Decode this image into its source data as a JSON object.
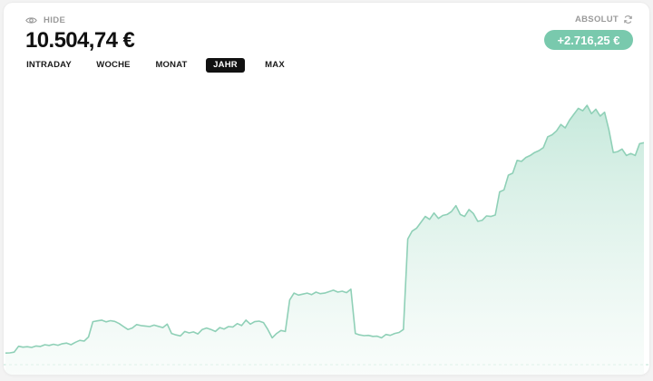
{
  "header": {
    "hide_label": "HIDE",
    "balance": "10.504,74 €",
    "mode_label": "ABSOLUT",
    "change": "+2.716,25 €"
  },
  "tabs": [
    {
      "label": "INTRADAY",
      "active": false
    },
    {
      "label": "WOCHE",
      "active": false
    },
    {
      "label": "MONAT",
      "active": false
    },
    {
      "label": "JAHR",
      "active": true
    },
    {
      "label": "MAX",
      "active": false
    }
  ],
  "colors": {
    "line": "#8fd0b7",
    "fill_top": "#c4e8da",
    "fill_bottom": "#f5fbf8",
    "badge": "#79c9ad",
    "baseline": "#bde3d3"
  },
  "icons": {
    "hide": "eye-icon",
    "mode": "refresh-icon"
  },
  "chart_data": {
    "type": "area",
    "title": "",
    "xlabel": "",
    "ylabel": "",
    "ylim": [
      7700,
      10800
    ],
    "values": [
      7790,
      7792,
      7800,
      7860,
      7850,
      7855,
      7848,
      7862,
      7858,
      7875,
      7868,
      7880,
      7870,
      7885,
      7892,
      7875,
      7900,
      7920,
      7912,
      7955,
      8110,
      8118,
      8125,
      8108,
      8120,
      8112,
      8090,
      8060,
      8030,
      8045,
      8080,
      8070,
      8065,
      8060,
      8075,
      8062,
      8050,
      8085,
      7990,
      7975,
      7965,
      8010,
      7995,
      8005,
      7985,
      8030,
      8045,
      8030,
      8010,
      8050,
      8035,
      8060,
      8055,
      8090,
      8070,
      8125,
      8085,
      8110,
      8115,
      8100,
      8030,
      7945,
      7990,
      8020,
      8010,
      8330,
      8400,
      8380,
      8390,
      8400,
      8385,
      8410,
      8395,
      8400,
      8415,
      8430,
      8410,
      8420,
      8405,
      8440,
      7990,
      7975,
      7968,
      7970,
      7960,
      7962,
      7945,
      7980,
      7970,
      7990,
      8000,
      8030,
      8950,
      9030,
      9060,
      9120,
      9180,
      9150,
      9215,
      9160,
      9190,
      9200,
      9230,
      9290,
      9200,
      9180,
      9250,
      9210,
      9130,
      9140,
      9185,
      9180,
      9195,
      9430,
      9450,
      9600,
      9620,
      9750,
      9740,
      9780,
      9800,
      9830,
      9850,
      9880,
      9990,
      10010,
      10050,
      10115,
      10080,
      10160,
      10220,
      10280,
      10255,
      10310,
      10225,
      10270,
      10200,
      10240,
      10060,
      9830,
      9840,
      9865,
      9800,
      9820,
      9800,
      9920,
      9930
    ]
  }
}
